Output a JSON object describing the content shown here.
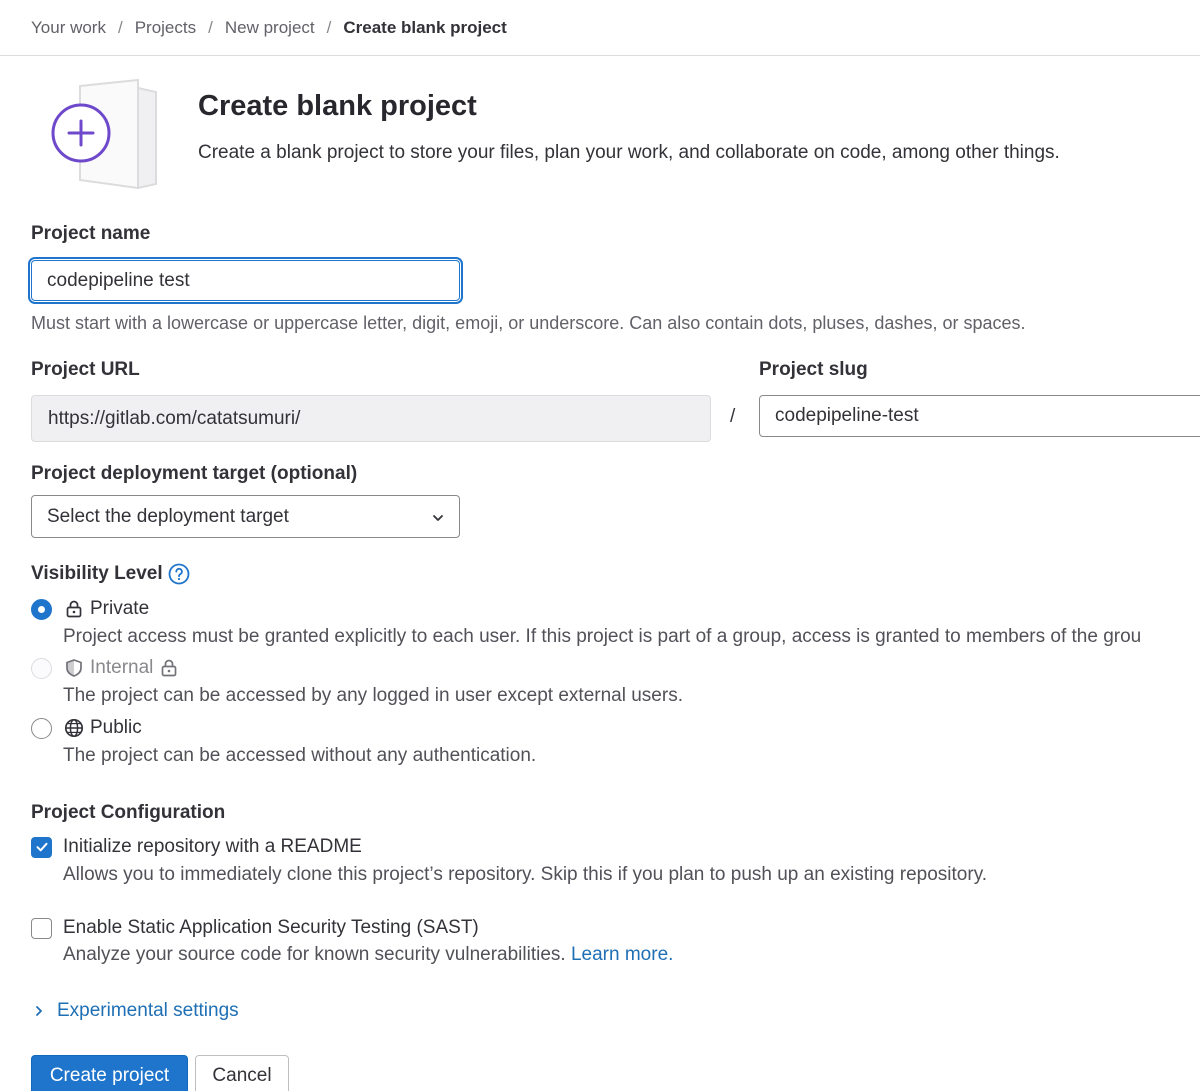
{
  "breadcrumb": {
    "items": [
      "Your work",
      "Projects",
      "New project"
    ],
    "current": "Create blank project",
    "separator": "/"
  },
  "header": {
    "title": "Create blank project",
    "description": "Create a blank project to store your files, plan your work, and collaborate on code, among other things."
  },
  "project_name": {
    "label": "Project name",
    "value": "codepipeline test",
    "help": "Must start with a lowercase or uppercase letter, digit, emoji, or underscore. Can also contain dots, pluses, dashes, or spaces."
  },
  "project_url": {
    "label": "Project URL",
    "prefix": "https://gitlab.com/catatsumuri/",
    "separator": "/"
  },
  "project_slug": {
    "label": "Project slug",
    "value": "codepipeline-test"
  },
  "deployment_target": {
    "label": "Project deployment target (optional)",
    "selected": "Select the deployment target"
  },
  "visibility": {
    "label": "Visibility Level",
    "options": [
      {
        "label": "Private",
        "description": "Project access must be granted explicitly to each user. If this project is part of a group, access is granted to members of the grou",
        "state": "checked",
        "icon": "lock-icon"
      },
      {
        "label": "Internal",
        "description": "The project can be accessed by any logged in user except external users.",
        "state": "disabled",
        "icon": "shield-icon"
      },
      {
        "label": "Public",
        "description": "The project can be accessed without any authentication.",
        "state": "unchecked",
        "icon": "globe-icon"
      }
    ]
  },
  "configuration": {
    "label": "Project Configuration",
    "readme": {
      "label": "Initialize repository with a README",
      "description": "Allows you to immediately clone this project’s repository. Skip this if you plan to push up an existing repository.",
      "checked": true
    },
    "sast": {
      "label": "Enable Static Application Security Testing (SAST)",
      "description": "Analyze your source code for known security vulnerabilities.",
      "link": "Learn more.",
      "checked": false
    }
  },
  "experimental": {
    "label": "Experimental settings"
  },
  "actions": {
    "create": "Create project",
    "cancel": "Cancel"
  },
  "colors": {
    "accent": "#1f75cb",
    "illustration": "#6e49cb",
    "link": "#1f6fb5"
  }
}
